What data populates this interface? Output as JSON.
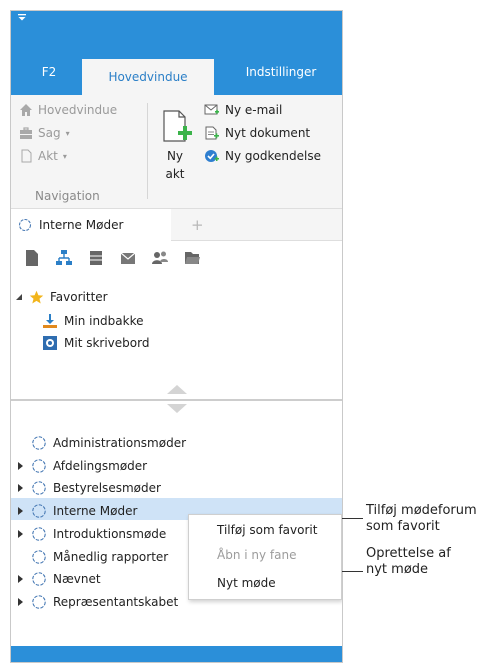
{
  "tabs": {
    "f2": "F2",
    "main": "Hovedvindue",
    "settings": "Indstillinger"
  },
  "ribbon": {
    "home": "Hovedvindue",
    "case": "Sag",
    "act": "Akt",
    "new_act_line1": "Ny",
    "new_act_line2": "akt",
    "new_email": "Ny e-mail",
    "new_document": "Nyt dokument",
    "new_approval": "Ny godkendelse",
    "group_label": "Navigation"
  },
  "doc_tab": {
    "label": "Interne Møder",
    "add": "+"
  },
  "favorites": {
    "label": "Favoritter",
    "items": [
      "Min indbakke",
      "Mit skrivebord"
    ]
  },
  "tree": [
    {
      "label": "Administrationsmøder",
      "expandable": false
    },
    {
      "label": "Afdelingsmøder",
      "expandable": true
    },
    {
      "label": "Bestyrelsesmøder",
      "expandable": true
    },
    {
      "label": "Interne Møder",
      "expandable": true,
      "selected": true
    },
    {
      "label": "Introduktionsmøde",
      "expandable": true
    },
    {
      "label": "Månedlig rapporter",
      "expandable": false
    },
    {
      "label": "Nævnet",
      "expandable": true
    },
    {
      "label": "Repræsentantskabet",
      "expandable": true
    }
  ],
  "context_menu": {
    "add_favorite": "Tilføj som favorit",
    "open_new_tab": "Åbn i ny fane",
    "new_meeting": "Nyt møde"
  },
  "callouts": {
    "favorite_line1": "Tilføj mødeforum",
    "favorite_line2": "som favorit",
    "meeting_line1": "Oprettelse af",
    "meeting_line2": "nyt møde"
  },
  "colors": {
    "accent": "#2b8fd9",
    "selection": "#cfe3f7",
    "favorite_star": "#f2b51c"
  }
}
